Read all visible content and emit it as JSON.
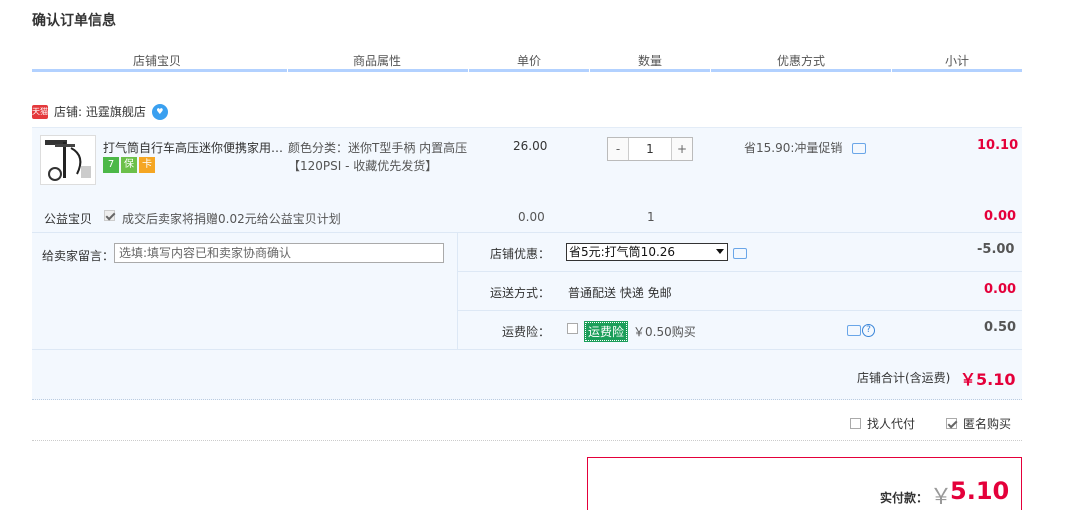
{
  "page_title": "确认订单信息",
  "columns": [
    "店铺宝贝",
    "商品属性",
    "单价",
    "数量",
    "优惠方式",
    "小计"
  ],
  "shop": {
    "badge": "天猫",
    "name": "店铺: 迅霆旗舰店"
  },
  "item": {
    "title": "打气筒自行车高压迷你便携家用…",
    "badges": [
      {
        "text": "7",
        "color": "#4cb848"
      },
      {
        "text": "保",
        "color": "#6cc04a"
      },
      {
        "text": "卡",
        "color": "#f5a623"
      }
    ],
    "attr_line1": "颜色分类：迷你T型手柄 内置高压",
    "attr_line2": "【120PSI - 收藏优先发货】",
    "price": "26.00",
    "qty_minus": "-",
    "qty": "1",
    "qty_plus": "+",
    "discount": "省15.90:冲量促销",
    "subtotal": "10.10"
  },
  "charity": {
    "label": "公益宝贝",
    "text": "成交后卖家将捐赠0.02元给公益宝贝计划",
    "price": "0.00",
    "qty": "1",
    "subtotal": "0.00"
  },
  "memo": {
    "label": "给卖家留言：",
    "placeholder": "选填:填写内容已和卖家协商确认"
  },
  "shop_discount": {
    "label": "店铺优惠：",
    "selected": "省5元:打气筒10.26",
    "amount": "-5.00"
  },
  "shipping": {
    "label": "运送方式：",
    "value": "普通配送 快递 免邮",
    "amount": "0.00"
  },
  "insurance": {
    "label": "运费险：",
    "badge": "运费险",
    "text": "￥0.50购买",
    "amount": "0.50"
  },
  "shop_total": {
    "label": "店铺合计(含运费)",
    "value": "￥5.10"
  },
  "options": {
    "proxy": "找人代付",
    "anonymous": "匿名购买"
  },
  "payment": {
    "label": "实付款：",
    "currency": "￥",
    "value": "5.10"
  }
}
